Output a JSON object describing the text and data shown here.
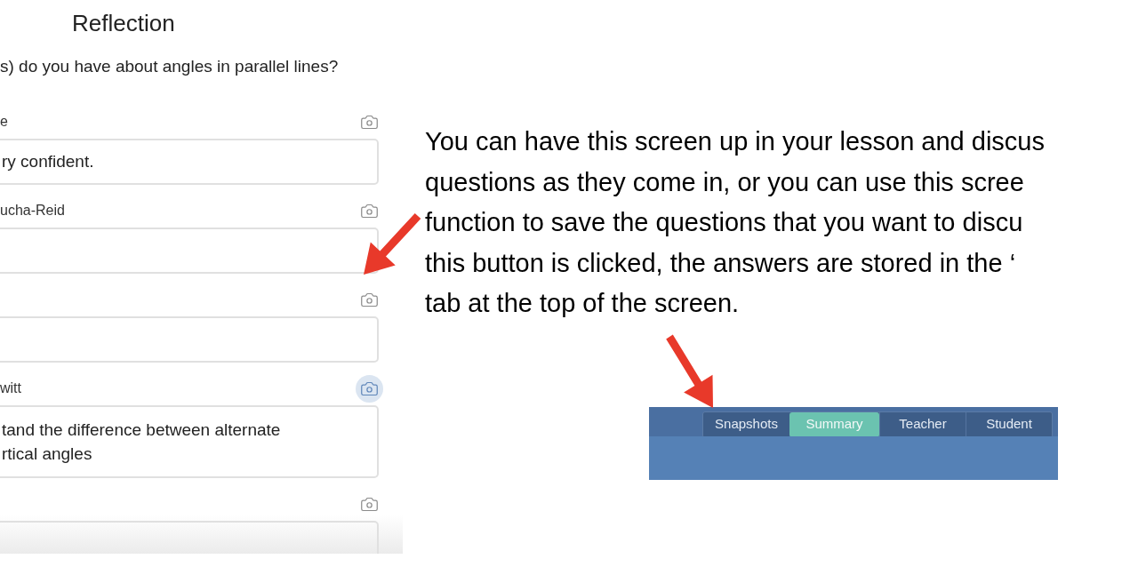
{
  "reflection_panel": {
    "title": "Reflection",
    "question": "s) do you have about angles in parallel lines?",
    "responses": [
      {
        "name": "e",
        "answer": "ry confident.",
        "snapshot_highlighted": false
      },
      {
        "name": "ucha-Reid",
        "snapshot_highlighted": false
      },
      {
        "snapshot_highlighted": false
      },
      {
        "name": "witt",
        "answer": "tand the difference between alternate\nrtical angles",
        "snapshot_highlighted": true
      },
      {
        "snapshot_highlighted": false
      }
    ]
  },
  "instruction": {
    "lines": [
      "You can have this screen up in your lesson and discus",
      "questions as they come in, or you can use this scree",
      "function to save the questions that you want to discu",
      "this button is clicked, the answers are stored in the ‘",
      "tab at the top of the screen."
    ]
  },
  "tab_bar": {
    "tabs": [
      {
        "label": "Snapshots",
        "selected": false
      },
      {
        "label": "Summary",
        "selected": true
      },
      {
        "label": "Teacher",
        "selected": false
      },
      {
        "label": "Student",
        "selected": false
      }
    ]
  }
}
